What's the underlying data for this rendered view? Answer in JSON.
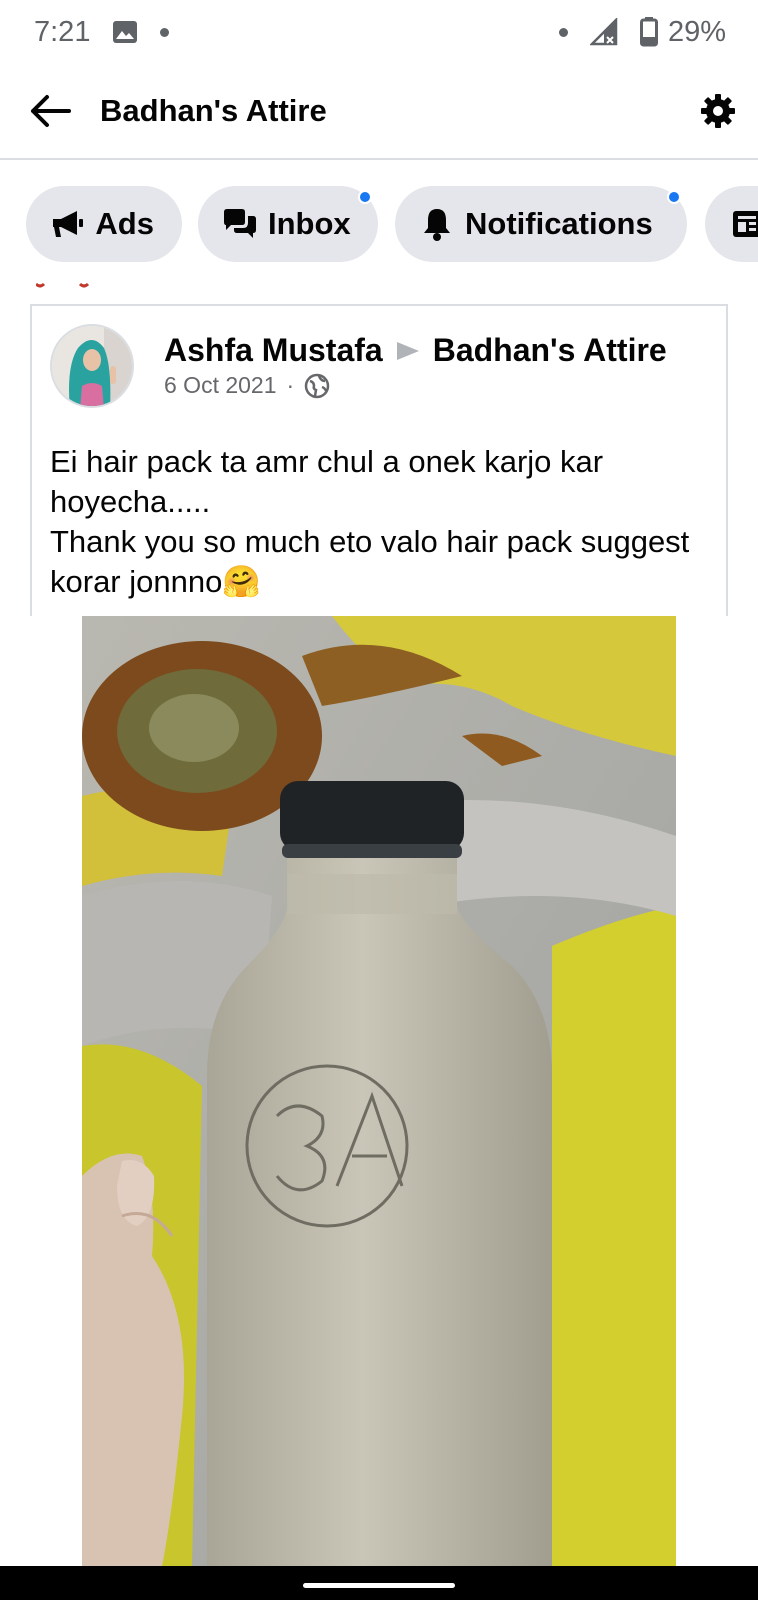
{
  "status_bar": {
    "time": "7:21",
    "battery": "29%",
    "icons": [
      "gallery-icon",
      "dot-icon",
      "signal-icon",
      "battery-icon"
    ]
  },
  "header": {
    "title": "Badhan's Attire",
    "back_icon": "arrow-left-icon",
    "settings_icon": "gear-icon"
  },
  "chips": [
    {
      "label": "Ads",
      "icon": "megaphone-icon",
      "has_dot": false
    },
    {
      "label": "Inbox",
      "icon": "chat-bubbles-icon",
      "has_dot": true
    },
    {
      "label": "Notifications",
      "icon": "bell-icon",
      "has_dot": true
    }
  ],
  "post": {
    "author": "Ashfa Mustafa",
    "target": "Badhan's Attire",
    "date": "6 Oct 2021",
    "separator": "·",
    "privacy_icon": "globe-icon",
    "text_lines": [
      "Ei hair pack ta  amr chul a onek karjo kar hoyecha.....",
      "Thank you so much eto valo hair pack suggest korar jonnno🤗"
    ]
  },
  "colors": {
    "accent": "#1877f2",
    "chip_bg": "#e4e6eb",
    "divider": "#dadde1",
    "secondary_text": "#65676b"
  }
}
